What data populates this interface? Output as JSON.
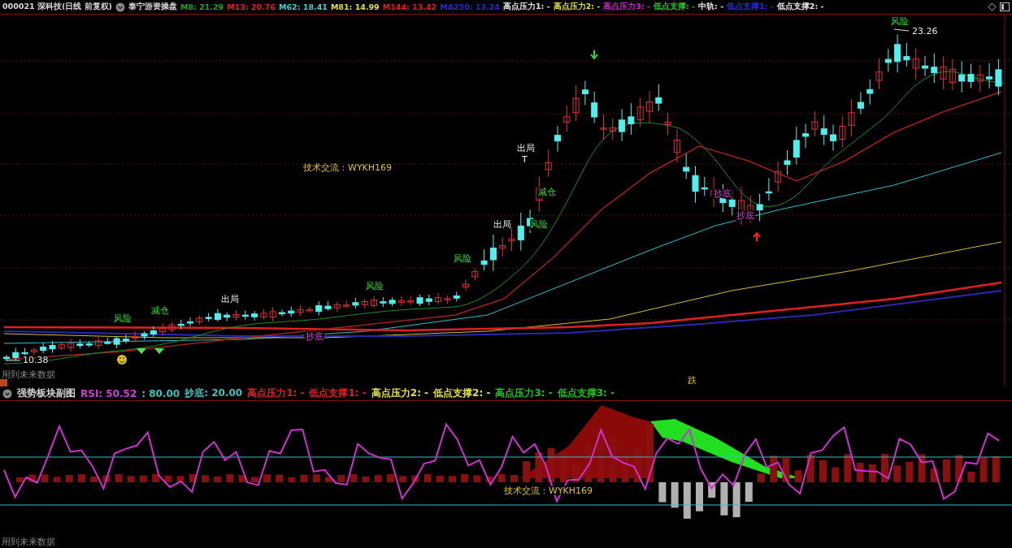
{
  "main_panel": {
    "security": "000021 深科技(日线 前复权)",
    "indicator": "泰宁游资操盘",
    "legend": [
      {
        "label": "M8: 21.29",
        "color": "#22a022"
      },
      {
        "label": "M13: 20.76",
        "color": "#e02020"
      },
      {
        "label": "M62: 18.41",
        "color": "#40d0d0"
      },
      {
        "label": "M81: 14.99",
        "color": "#e0e040"
      },
      {
        "label": "M144: 13.42",
        "color": "#e02020"
      },
      {
        "label": "MA250: 13.24",
        "color": "#2030c0"
      },
      {
        "label": "高点压力1: -",
        "color": "#e8e8e8"
      },
      {
        "label": "高点压力2: -",
        "color": "#e0e040"
      },
      {
        "label": "高点压力3: -",
        "color": "#d020d0"
      },
      {
        "label": "低点支撑: -",
        "color": "#20d020"
      },
      {
        "label": "中轨: -",
        "color": "#e8e8e8"
      },
      {
        "label": "低点支撑1: -",
        "color": "#2030e0"
      },
      {
        "label": "低点支撑2: -",
        "color": "#e8e8e8"
      }
    ],
    "annotations": [
      {
        "text": "10.38",
        "kind": "price"
      },
      {
        "text": "23.26",
        "kind": "price"
      },
      {
        "text": "技术交流：WYKH169",
        "kind": "info"
      },
      {
        "text": "风险",
        "kind": "risk"
      },
      {
        "text": "减仓",
        "kind": "risk"
      },
      {
        "text": "出局",
        "kind": "exit"
      },
      {
        "text": "风险",
        "kind": "risk"
      },
      {
        "text": "风险",
        "kind": "risk"
      },
      {
        "text": "出局",
        "kind": "exit"
      },
      {
        "text": "风险",
        "kind": "risk"
      },
      {
        "text": "减仓",
        "kind": "risk"
      },
      {
        "text": "出局",
        "kind": "exit"
      },
      {
        "text": "T",
        "kind": "exit"
      },
      {
        "text": "风险",
        "kind": "risk"
      },
      {
        "text": "抄底",
        "kind": "bottom"
      },
      {
        "text": "抄底",
        "kind": "bottom"
      },
      {
        "text": "抄底",
        "kind": "bottom"
      },
      {
        "text": "跌",
        "kind": "info"
      }
    ],
    "note": "用到未来数据"
  },
  "sub_panel": {
    "indicator": "强势板块副图",
    "legend": [
      {
        "label": "RSI: 50.52",
        "color": "#d040d0"
      },
      {
        "label": ": 80.00",
        "color": "#40c0c0"
      },
      {
        "label": "抄底: 20.00",
        "color": "#40c0c0"
      },
      {
        "label": "高点压力1: -",
        "color": "#e02020"
      },
      {
        "label": "低点支撑1: -",
        "color": "#e02020"
      },
      {
        "label": "高点压力2: -",
        "color": "#e0e040"
      },
      {
        "label": "低点支撑2: -",
        "color": "#e0e040"
      },
      {
        "label": "高点压力3: -",
        "color": "#20c020"
      },
      {
        "label": "低点支撑3: -",
        "color": "#20c020"
      }
    ],
    "annotations": [
      {
        "text": "技术交流：WYKH169",
        "kind": "info"
      }
    ],
    "note": "用到未来数据"
  }
}
